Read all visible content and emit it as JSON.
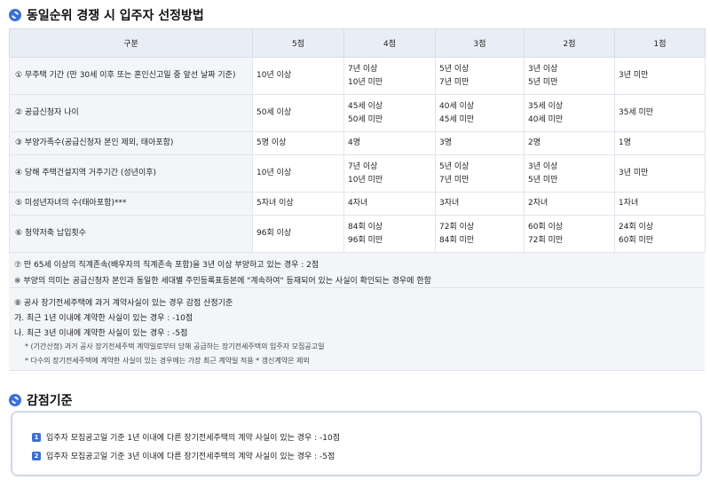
{
  "section1": {
    "title": "동일순위 경쟁 시 입주자 선정방법",
    "icon": "section-bullet-icon",
    "accent": "#3b6fd8",
    "table": {
      "headers": [
        "구분",
        "5점",
        "4점",
        "3점",
        "2점",
        "1점"
      ],
      "rows": [
        {
          "criterion": "① 무주택 기간 (만 30세 이후 또는 혼인신고일 중 앞선 날짜 기준)",
          "cells": [
            [
              "10년 이상"
            ],
            [
              "7년 이상",
              "10년 미만"
            ],
            [
              "5년 이상",
              "7년 미만"
            ],
            [
              "3년 이상",
              "5년 미만"
            ],
            [
              "3년 미만"
            ]
          ]
        },
        {
          "criterion": "② 공급신청자 나이",
          "cells": [
            [
              "50세 이상"
            ],
            [
              "45세 이상",
              "50세 미만"
            ],
            [
              "40세 이상",
              "45세 미만"
            ],
            [
              "35세 이상",
              "40세 미만"
            ],
            [
              "35세 미만"
            ]
          ]
        },
        {
          "criterion": "③ 부양가족수(공급신청자 본인 제외, 태아포함)",
          "cells": [
            [
              "5명 이상"
            ],
            [
              "4명"
            ],
            [
              "3명"
            ],
            [
              "2명"
            ],
            [
              "1명"
            ]
          ]
        },
        {
          "criterion": "④ 당해 주택건설지역 거주기간 (성년이후)",
          "cells": [
            [
              "10년 이상"
            ],
            [
              "7년 이상",
              "10년 미만"
            ],
            [
              "5년 이상",
              "7년 미만"
            ],
            [
              "3년 이상",
              "5년 미만"
            ],
            [
              "3년 미만"
            ]
          ]
        },
        {
          "criterion": "⑤ 미성년자녀의 수(태아포함)***",
          "cells": [
            [
              "5자녀 이상"
            ],
            [
              "4자녀"
            ],
            [
              "3자녀"
            ],
            [
              "2자녀"
            ],
            [
              "1자녀"
            ]
          ]
        },
        {
          "criterion": "⑥ 청약저축 납입횟수",
          "cells": [
            [
              "96회 이상"
            ],
            [
              "84회 이상",
              "96회 미만"
            ],
            [
              "72회 이상",
              "84회 미만"
            ],
            [
              "60회 이상",
              "72회 미만"
            ],
            [
              "24회 이상",
              "60회 미만"
            ]
          ]
        }
      ]
    },
    "note1": {
      "line1": "⑦ 만 65세 이상의 직계존속(배우자의 직계존속 포함)을 3년 이상 부양하고 있는 경우 : 2점",
      "line2": "※  부양의 의미는 공급신청자 본인과 동일한 세대별 주민등록표등본에 \"계속하여\" 등재되어 있는 사실이 확인되는 경우에 한함"
    },
    "note2": {
      "line1": "⑧ 공사 장기전세주택에 과거 계약사실이 있는 경우 감점 산정기준",
      "line2": "가. 최근 1년 이내에 계약한 사실이 있는 경우 : -10점",
      "line3": "나. 최근 3년 이내에 계약한 사실이 있는 경우 : -5점",
      "sub1": "* (기간산정) 과거 공사 장기전세주택 계약일로부터 당해 공급하는 장기전세주택의 입주자 모집공고일",
      "sub2": "* 다수의 장기전세주택에 계약한 사실이 있는 경우에는 가장 최근 계약일 적용 * 갱신계약은 제외"
    }
  },
  "section2": {
    "title": "감점기준",
    "items": [
      {
        "num": "1",
        "text": "입주자 모집공고일 기준 1년 이내에 다른 장기전세주택의 계약 사실이 있는 경우 : -10점"
      },
      {
        "num": "2",
        "text": "입주자 모집공고일 기준 3년 이내에 다른 장기전세주택의 계약 사실이 있는 경우 : -5점"
      }
    ]
  }
}
